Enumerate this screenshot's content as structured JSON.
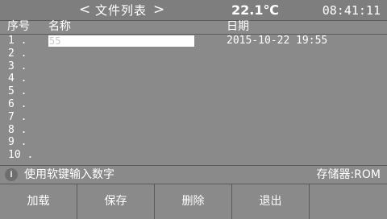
{
  "header": {
    "prev_glyph": "<",
    "title": "文件列表",
    "next_glyph": ">",
    "temperature": "22.1℃",
    "time": "08:41:11"
  },
  "table": {
    "col_no": "序号",
    "col_name": "名称",
    "col_date": "日期",
    "rows": [
      {
        "num": "1  .",
        "name": "55",
        "date": "2015-10-22 19:55"
      },
      {
        "num": "2  .",
        "name": "",
        "date": ""
      },
      {
        "num": "3  .",
        "name": "",
        "date": ""
      },
      {
        "num": "4  .",
        "name": "",
        "date": ""
      },
      {
        "num": "5  .",
        "name": "",
        "date": ""
      },
      {
        "num": "6  .",
        "name": "",
        "date": ""
      },
      {
        "num": "7  .",
        "name": "",
        "date": ""
      },
      {
        "num": "8  .",
        "name": "",
        "date": ""
      },
      {
        "num": "9  .",
        "name": "",
        "date": ""
      },
      {
        "num": "10 .",
        "name": "",
        "date": ""
      }
    ]
  },
  "status": {
    "hint": "使用软键输入数字",
    "storage": "存储器:ROM",
    "info_icon": "info-icon"
  },
  "softkeys": [
    "加载",
    "保存",
    "删除",
    "退出",
    ""
  ]
}
